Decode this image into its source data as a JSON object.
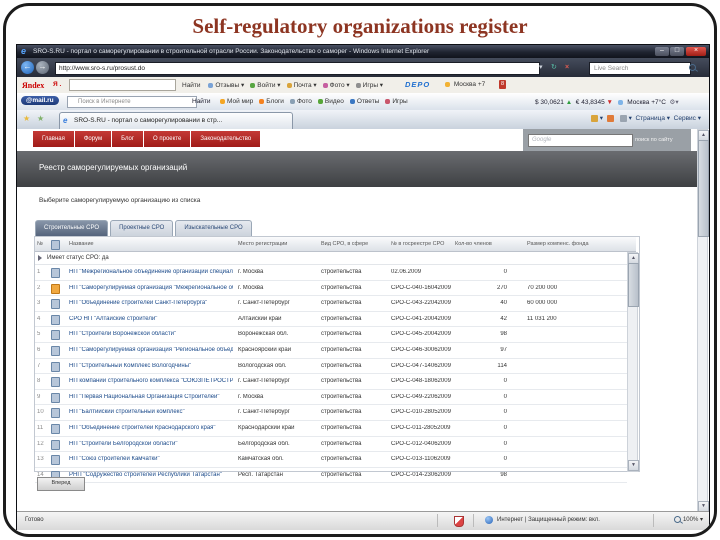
{
  "slide": {
    "title": "Self-regulatory organizations register"
  },
  "browser": {
    "title": "SRO-S.RU - портал о саморегулировании в строительной отрасли России. Законодательство о саморег - Windows Internet Explorer",
    "address": "http://www.sro-s.ru/prosust.do",
    "search_placeholder": "Live Search",
    "tab": {
      "label": "SRO-S.RU - портал о саморегулировании в стр..."
    },
    "menus": {
      "page": "Страница",
      "tools": "Сервис"
    },
    "status": {
      "ready": "Готово",
      "zone": "Интернет | Защищенный режим: вкл.",
      "zoom": "100%"
    }
  },
  "yandex_toolbar": {
    "logo": "Яndex",
    "profile": "Я .",
    "find": "Найти",
    "items": [
      "Отзывы",
      "Войти",
      "Почта",
      "Фото",
      "Игры"
    ],
    "depo": "DEPO",
    "city": "Москва",
    "temp": "+7",
    "battery": "8"
  },
  "mailru_toolbar": {
    "logo": "@mail.ru",
    "search_placeholder": "Поиск в Интернете",
    "find": "Найти",
    "items": [
      "Мой мир",
      "Блоги",
      "Фото",
      "Видео",
      "Ответы",
      "Игры"
    ],
    "usd": "$ 30,0621",
    "eur": "€ 43,8345",
    "weather": "Москва +7°C"
  },
  "site": {
    "menu": [
      "Главная",
      "Форум",
      "Блог",
      "О проекте",
      "Законодательство"
    ],
    "search_watermark": "Google",
    "search_label": "поиск по сайту",
    "page_title": "Реестр саморегулируемых организаций",
    "subtitle": "Выберите саморегулируемую организацию из списка",
    "tabs": [
      "Строительные СРО",
      "Проектные СРО",
      "Изыскательные СРО"
    ],
    "next_button": "Вперед",
    "table": {
      "group": "Имеет статус СРО: да",
      "headers": [
        "№",
        "Название",
        "Место регистрации",
        "Вид СРО, в сфере",
        "№ в госреестре СРО",
        "Кол-во членов",
        "Размер компенс. фонда"
      ],
      "rows": [
        {
          "num": 1,
          "star": false,
          "name": "НП \"Межрегиональное объединение организаций специального строитель...\"",
          "place": "г. Москва",
          "kind": "строительства",
          "reg": "02.06.2009",
          "members": "0",
          "fund": ""
        },
        {
          "num": 2,
          "star": true,
          "name": "НП \"Саморегулируемая организация \"Межрегиональное объединение стро...\"",
          "place": "г. Москва",
          "kind": "строительства",
          "reg": "СРО-С-040-16042009",
          "members": "270",
          "fund": "70 200 000"
        },
        {
          "num": 3,
          "star": false,
          "name": "НП \"Объединение строителей Санкт-Петербурга\"",
          "place": "г. Санкт-Петербург",
          "kind": "строительства",
          "reg": "СРО-С-043-22042009",
          "members": "40",
          "fund": "60 000 000"
        },
        {
          "num": 4,
          "star": false,
          "name": "СРО НП \"Алтайские строители\"",
          "place": "Алтайский край",
          "kind": "строительства",
          "reg": "СРО-С-041-20042009",
          "members": "42",
          "fund": "11 031 200"
        },
        {
          "num": 5,
          "star": false,
          "name": "НП \"Строители Воронежской области\"",
          "place": "Воронежская обл.",
          "kind": "строительства",
          "reg": "СРО-С-045-20042009",
          "members": "98",
          "fund": ""
        },
        {
          "num": 6,
          "star": false,
          "name": "НП \"Саморегулируемая организация \"Региональное объединение строител...\"",
          "place": "Красноярский край",
          "kind": "строительства",
          "reg": "СРО-С-046-30062009",
          "members": "97",
          "fund": ""
        },
        {
          "num": 7,
          "star": false,
          "name": "НП \"Строительный Комплекс Вологодчины\"",
          "place": "Вологодская обл.",
          "kind": "строительства",
          "reg": "СРО-С-047-14062009",
          "members": "114",
          "fund": ""
        },
        {
          "num": 8,
          "star": false,
          "name": "НП компаний строительного комплекса \"СОЮЗПЕТРОСТРОЙ-СТАНДАРТ\"",
          "place": "г. Санкт-Петербург",
          "kind": "строительства",
          "reg": "СРО-С-048-18062009",
          "members": "0",
          "fund": ""
        },
        {
          "num": 9,
          "star": false,
          "name": "НП \"Первая Национальная Организация Строителей\"",
          "place": "г. Москва",
          "kind": "строительства",
          "reg": "СРО-С-049-22062009",
          "members": "0",
          "fund": ""
        },
        {
          "num": 10,
          "star": false,
          "name": "НП \"Балтийский строительный комплекс\"",
          "place": "г. Санкт-Петербург",
          "kind": "строительства",
          "reg": "СРО-С-010-28052009",
          "members": "0",
          "fund": ""
        },
        {
          "num": 11,
          "star": false,
          "name": "НП \"Объединение строителей Краснодарского края\"",
          "place": "Краснодарский край",
          "kind": "строительства",
          "reg": "СРО-С-011-28052009",
          "members": "0",
          "fund": ""
        },
        {
          "num": 12,
          "star": false,
          "name": "НП \"Строители Белгородской области\"",
          "place": "Белгородская обл.",
          "kind": "строительства",
          "reg": "СРО-С-012-04062009",
          "members": "0",
          "fund": ""
        },
        {
          "num": 13,
          "star": false,
          "name": "НП \"Союз строителей Камчатки\"",
          "place": "Камчатская обл.",
          "kind": "строительства",
          "reg": "СРО-С-013-11062009",
          "members": "0",
          "fund": ""
        },
        {
          "num": 14,
          "star": false,
          "name": "РНП \"Содружество строителей Республики Татарстан\"",
          "place": "Респ. Татарстан",
          "kind": "строительства",
          "reg": "СРО-С-014-23062009",
          "members": "98",
          "fund": ""
        }
      ]
    }
  }
}
